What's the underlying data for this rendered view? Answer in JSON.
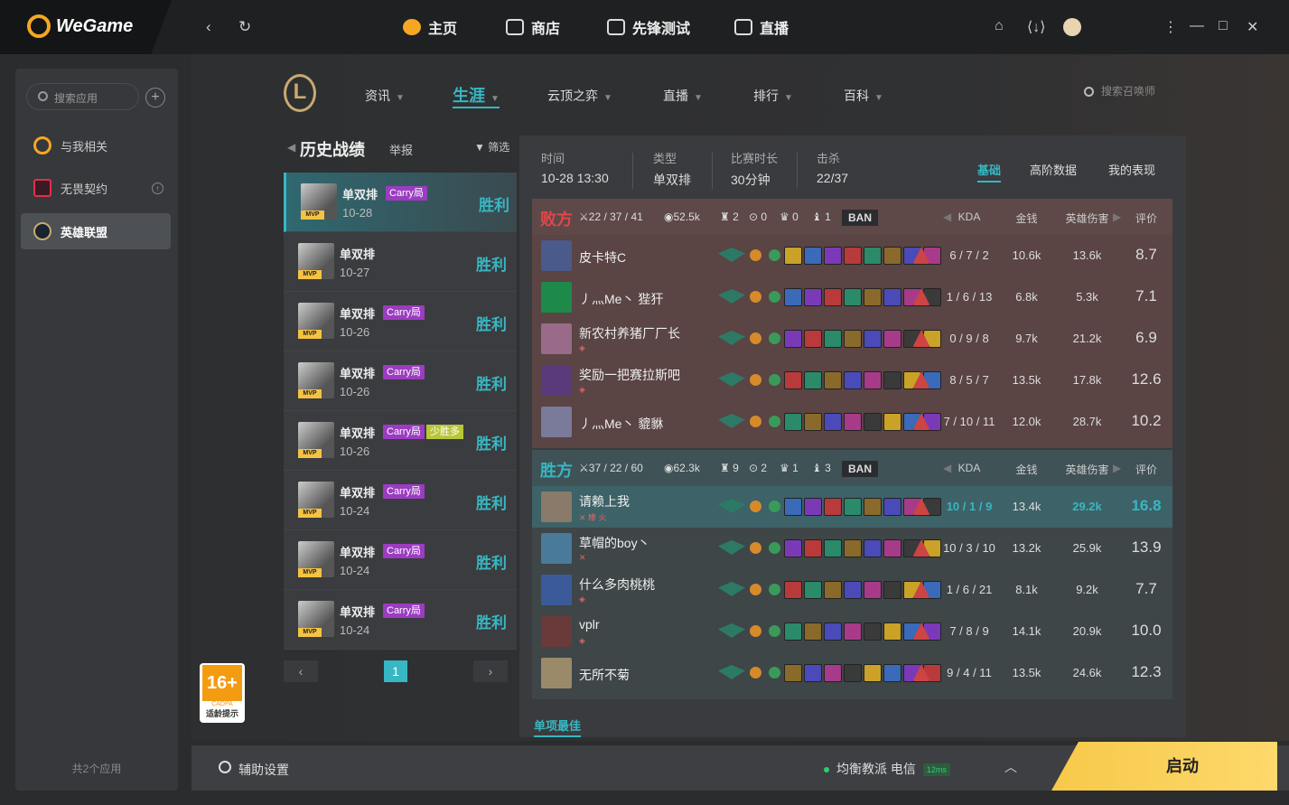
{
  "topbar": {
    "brand": "WeGame",
    "nav": [
      "主页",
      "商店",
      "先锋测试",
      "直播"
    ]
  },
  "sidebar": {
    "search_placeholder": "搜索应用",
    "apps": [
      {
        "label": "与我相关",
        "color": "#f5a623"
      },
      {
        "label": "无畏契约",
        "color": "#e0304a"
      },
      {
        "label": "英雄联盟",
        "color": "#c8aa6e"
      }
    ],
    "footer": "共2个应用"
  },
  "lol": {
    "logo": "L",
    "nav": [
      "资讯",
      "生涯",
      "云顶之弈",
      "直播",
      "排行",
      "百科"
    ],
    "active_nav": "生涯",
    "summoner_search_placeholder": "搜索召唤师"
  },
  "history": {
    "title": "历史战绩",
    "report": "举报",
    "filter": "筛选",
    "games": [
      {
        "mode": "单双排",
        "tag": "Carry局",
        "extra": "",
        "date": "10-28",
        "result": "胜利"
      },
      {
        "mode": "单双排",
        "tag": "",
        "extra": "",
        "date": "10-27",
        "result": "胜利"
      },
      {
        "mode": "单双排",
        "tag": "Carry局",
        "extra": "",
        "date": "10-26",
        "result": "胜利"
      },
      {
        "mode": "单双排",
        "tag": "Carry局",
        "extra": "",
        "date": "10-26",
        "result": "胜利"
      },
      {
        "mode": "单双排",
        "tag": "Carry局",
        "extra": "少胜多",
        "date": "10-26",
        "result": "胜利"
      },
      {
        "mode": "单双排",
        "tag": "Carry局",
        "extra": "",
        "date": "10-24",
        "result": "胜利"
      },
      {
        "mode": "单双排",
        "tag": "Carry局",
        "extra": "",
        "date": "10-24",
        "result": "胜利"
      },
      {
        "mode": "单双排",
        "tag": "Carry局",
        "extra": "",
        "date": "10-24",
        "result": "胜利"
      }
    ],
    "mvp_label": "MVP",
    "page": "1",
    "prev": "‹",
    "next": "›"
  },
  "detail": {
    "info": [
      {
        "label": "时间",
        "value": "10-28 13:30"
      },
      {
        "label": "类型",
        "value": "单双排"
      },
      {
        "label": "比赛时长",
        "value": "30分钟"
      },
      {
        "label": "击杀",
        "value": "22/37"
      }
    ],
    "tabs": [
      "基础",
      "高阶数据",
      "我的表现"
    ],
    "columns": {
      "kda": "KDA",
      "gold": "金钱",
      "dmg": "英雄伤害",
      "score": "评价"
    },
    "ban_label": "BAN",
    "teams": [
      {
        "name": "败方",
        "color": "#e04848",
        "bg": "#5a4444",
        "head_bg": "#5e4848",
        "kda": "22 / 37 / 41",
        "gold": "52.5k",
        "towers": "2",
        "dragons": "0",
        "barons": "0",
        "heralds": "1",
        "players": [
          {
            "name": "皮卡特C",
            "sub": "",
            "kda": "6 / 7 / 2",
            "gold": "10.6k",
            "dmg": "13.6k",
            "score": "8.7",
            "avatar": "#4a5a8a"
          },
          {
            "name": "丿灬Me丶 狴犴",
            "sub": "",
            "kda": "1 / 6 / 13",
            "gold": "6.8k",
            "dmg": "5.3k",
            "score": "7.1",
            "avatar": "#1e8a4a"
          },
          {
            "name": "新农村养猪厂厂长",
            "sub": "◈",
            "kda": "0 / 9 / 8",
            "gold": "9.7k",
            "dmg": "21.2k",
            "score": "6.9",
            "avatar": "#9a6a8a"
          },
          {
            "name": "奖励一把赛拉斯吧",
            "sub": "◈",
            "kda": "8 / 5 / 7",
            "gold": "13.5k",
            "dmg": "17.8k",
            "score": "12.6",
            "avatar": "#5a3a7a"
          },
          {
            "name": "丿灬Me丶 貔貅",
            "sub": "",
            "kda": "7 / 10 / 11",
            "gold": "12.0k",
            "dmg": "28.7k",
            "score": "10.2",
            "avatar": "#7a7a9a"
          }
        ]
      },
      {
        "name": "胜方",
        "color": "#37b7c3",
        "bg": "#3e4648",
        "head_bg": "#3f5256",
        "kda": "37 / 22 / 60",
        "gold": "62.3k",
        "towers": "9",
        "dragons": "2",
        "barons": "1",
        "heralds": "3",
        "players": [
          {
            "name": "请赖上我",
            "sub": "✕ 棒 火",
            "kda": "10 / 1 / 9",
            "gold": "13.4k",
            "dmg": "29.2k",
            "score": "16.8",
            "avatar": "#8a7a6a",
            "me": true
          },
          {
            "name": "草帽的boy丶",
            "sub": "✕",
            "kda": "10 / 3 / 10",
            "gold": "13.2k",
            "dmg": "25.9k",
            "score": "13.9",
            "avatar": "#4a7a9a"
          },
          {
            "name": "什么多肉桃桃",
            "sub": "◈",
            "kda": "1 / 6 / 21",
            "gold": "8.1k",
            "dmg": "9.2k",
            "score": "7.7",
            "avatar": "#3a5a9a"
          },
          {
            "name": "vplr",
            "sub": "◈",
            "kda": "7 / 8 / 9",
            "gold": "14.1k",
            "dmg": "20.9k",
            "score": "10.0",
            "avatar": "#6a3a3a"
          },
          {
            "name": "无所不菊",
            "sub": "",
            "kda": "9 / 4 / 11",
            "gold": "13.5k",
            "dmg": "24.6k",
            "score": "12.3",
            "avatar": "#9a8a6a"
          }
        ]
      }
    ],
    "best_label": "单项最佳"
  },
  "bottombar": {
    "assist": "辅助设置",
    "server": "均衡教派 电信",
    "ping": "12ms",
    "launch": "启动"
  },
  "age_rating": {
    "number": "16+",
    "org": "CADPA",
    "tip": "适龄提示"
  }
}
